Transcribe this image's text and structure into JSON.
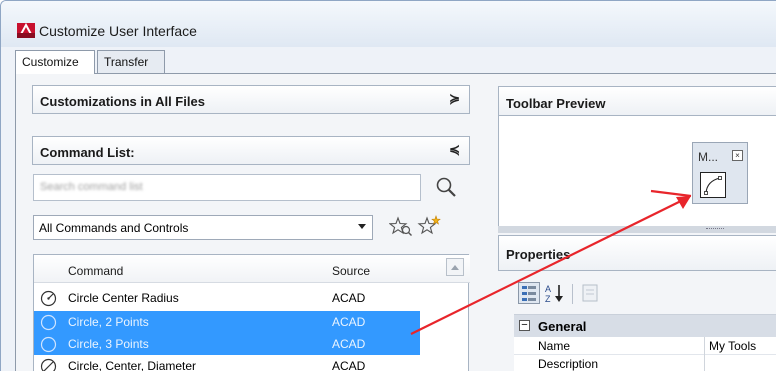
{
  "window": {
    "title": "Customize User Interface"
  },
  "tabs": [
    {
      "label": "Customize",
      "active": true
    },
    {
      "label": "Transfer",
      "active": false
    }
  ],
  "left": {
    "customizations_title": "Customizations in All Files",
    "command_list_title": "Command List:",
    "search": {
      "placeholder": "Search command list"
    },
    "filter": {
      "value": "All Commands and Controls"
    },
    "columns": {
      "command": "Command",
      "source": "Source"
    },
    "rows": [
      {
        "name": "Circle Center Radius",
        "source": "ACAD",
        "selected": false,
        "icon": "circle-radius-icon"
      },
      {
        "name": "Circle, 2 Points",
        "source": "ACAD",
        "selected": true,
        "icon": "circle-2point-icon"
      },
      {
        "name": "Circle, 3 Points",
        "source": "ACAD",
        "selected": true,
        "icon": "circle-3point-icon"
      },
      {
        "name": "Circle, Center, Diameter",
        "source": "ACAD",
        "selected": false,
        "icon": "circle-diameter-icon"
      }
    ]
  },
  "right": {
    "toolbar_preview_title": "Toolbar Preview",
    "mini_toolbar_title": "M...",
    "properties_title": "Properties",
    "properties": {
      "category": "General",
      "rows": [
        {
          "key": "Name",
          "value": "My Tools"
        },
        {
          "key": "Description",
          "value": ""
        }
      ]
    }
  },
  "colors": {
    "selection": "#3399ff",
    "annotation_arrow": "#e8252b",
    "panel_bg": "#f3f5f8"
  }
}
